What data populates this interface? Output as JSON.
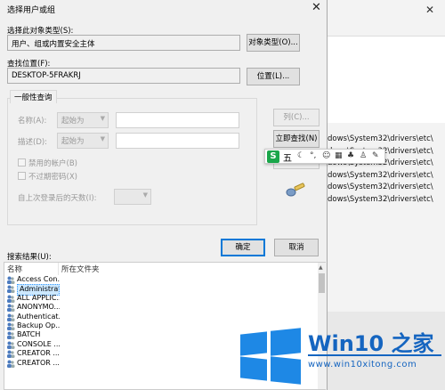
{
  "window": {
    "title": "选择用户或组",
    "close_glyph": "✕"
  },
  "object_type": {
    "label": "选择此对象类型(S):",
    "value": "用户、组或内置安全主体",
    "button": "对象类型(O)..."
  },
  "location": {
    "label": "查找位置(F):",
    "value": "DESKTOP-5FRAKRJ",
    "button": "位置(L)..."
  },
  "query": {
    "tab_label": "一般性查询",
    "name_label": "名称(A):",
    "name_combo": "起始为",
    "desc_label": "描述(D):",
    "desc_combo": "起始为",
    "disabled_accounts": "禁用的帐户(B)",
    "no_expire_pwd": "不过期密码(X)",
    "days_label": "自上次登录后的天数(I):",
    "columns_button": "列(C)...",
    "find_now_button": "立即查找(N)",
    "stop_button": "停止(T)"
  },
  "ime_toolbar": {
    "logo": "S",
    "mode": "五",
    "icons": [
      "moon-icon",
      "comma-icon",
      "smile-icon",
      "keyboard-icon",
      "shirt-icon",
      "person-icon",
      "wrench-icon"
    ]
  },
  "ok_button": "确定",
  "cancel_button": "取消",
  "results": {
    "label": "搜索结果(U):",
    "columns": [
      "名称",
      "所在文件夹"
    ],
    "rows": [
      {
        "name": "Access Con...",
        "folder": ""
      },
      {
        "name": "Administrat",
        "folder": ""
      },
      {
        "name": "ALL APPLIC...",
        "folder": ""
      },
      {
        "name": "ANONYMO...",
        "folder": ""
      },
      {
        "name": "Authenticat...",
        "folder": ""
      },
      {
        "name": "Backup Op...",
        "folder": ""
      },
      {
        "name": "BATCH",
        "folder": ""
      },
      {
        "name": "CONSOLE ...",
        "folder": ""
      },
      {
        "name": "CREATOR ...",
        "folder": ""
      },
      {
        "name": "CREATOR ...",
        "folder": ""
      }
    ],
    "selected_index": 1
  },
  "background": {
    "paths": [
      "dows\\System32\\drivers\\etc\\",
      "dows\\System32\\drivers\\etc\\",
      "dows\\System32\\drivers\\etc\\",
      "dows\\System32\\drivers\\etc\\",
      "dows\\System32\\drivers\\etc\\",
      "dows\\System32\\drivers\\etc\\"
    ]
  },
  "watermark": {
    "title": "Win10 之家",
    "url": "www.win10xitong.com"
  },
  "colors": {
    "accent": "#0078d7",
    "selection": "#cce8ff",
    "watermark": "#1565c0"
  }
}
